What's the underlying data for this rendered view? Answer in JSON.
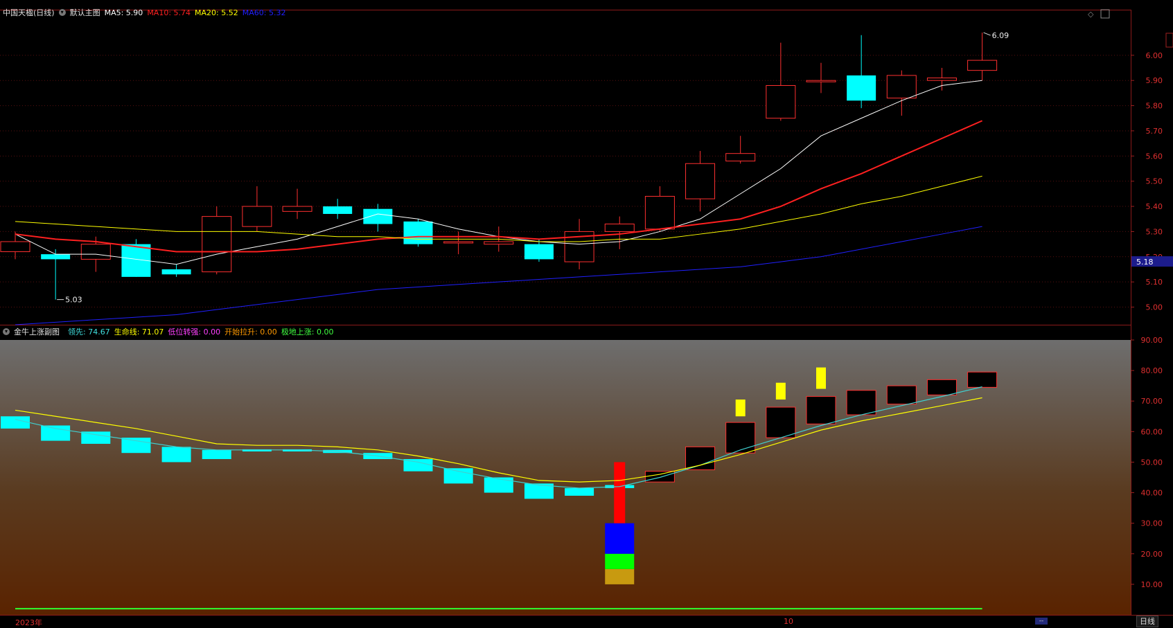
{
  "main_header": {
    "stock_name": "中国天楹(日线)",
    "indicator_name": "默认主图",
    "ma5": {
      "label": "MA5: 5.90",
      "color": "#ffffff"
    },
    "ma10": {
      "label": "MA10: 5.74",
      "color": "#ff2020"
    },
    "ma20": {
      "label": "MA20: 5.52",
      "color": "#ffff00"
    },
    "ma60": {
      "label": "MA60: 5.32",
      "color": "#2020ff"
    }
  },
  "sub_header": {
    "indicator_name": "金牛上涨副图",
    "lead": {
      "label": "领先: 74.67",
      "color": "#40e0e0"
    },
    "life": {
      "label": "生命线: 71.07",
      "color": "#ffff00"
    },
    "low_turn": {
      "label": "低位转强: 0.00",
      "color": "#ff40ff"
    },
    "start_rise": {
      "label": "开始拉升: 0.00",
      "color": "#ff9900"
    },
    "bottom_rise": {
      "label": "极地上涨: 0.00",
      "color": "#40ff40"
    }
  },
  "x_labels": {
    "year": "2023年",
    "month": "10"
  },
  "period_tab": "日线",
  "scroll_mark": "--",
  "chart_data": [
    {
      "type": "candlestick",
      "title": "中国天楹(日线)",
      "ylim": [
        4.93,
        6.17
      ],
      "yticks": [
        5.0,
        5.1,
        5.2,
        5.3,
        5.4,
        5.5,
        5.6,
        5.7,
        5.8,
        5.9,
        6.0
      ],
      "last_price_label": "5.18",
      "annotations": [
        {
          "text": "5.03",
          "index": 1
        },
        {
          "text": "6.09",
          "index": 24
        }
      ],
      "candles": [
        {
          "o": 5.22,
          "h": 5.3,
          "l": 5.19,
          "c": 5.26
        },
        {
          "o": 5.21,
          "h": 5.23,
          "l": 5.03,
          "c": 5.19
        },
        {
          "o": 5.19,
          "h": 5.28,
          "l": 5.14,
          "c": 5.25
        },
        {
          "o": 5.25,
          "h": 5.27,
          "l": 5.12,
          "c": 5.12
        },
        {
          "o": 5.15,
          "h": 5.17,
          "l": 5.12,
          "c": 5.13
        },
        {
          "o": 5.14,
          "h": 5.4,
          "l": 5.13,
          "c": 5.36
        },
        {
          "o": 5.32,
          "h": 5.48,
          "l": 5.3,
          "c": 5.4
        },
        {
          "o": 5.38,
          "h": 5.47,
          "l": 5.35,
          "c": 5.4
        },
        {
          "o": 5.4,
          "h": 5.43,
          "l": 5.35,
          "c": 5.37
        },
        {
          "o": 5.39,
          "h": 5.41,
          "l": 5.3,
          "c": 5.33
        },
        {
          "o": 5.34,
          "h": 5.35,
          "l": 5.24,
          "c": 5.25
        },
        {
          "o": 5.26,
          "h": 5.3,
          "l": 5.21,
          "c": 5.26
        },
        {
          "o": 5.25,
          "h": 5.32,
          "l": 5.22,
          "c": 5.26
        },
        {
          "o": 5.25,
          "h": 5.27,
          "l": 5.18,
          "c": 5.19
        },
        {
          "o": 5.18,
          "h": 5.35,
          "l": 5.15,
          "c": 5.3
        },
        {
          "o": 5.3,
          "h": 5.36,
          "l": 5.23,
          "c": 5.33
        },
        {
          "o": 5.31,
          "h": 5.48,
          "l": 5.3,
          "c": 5.44
        },
        {
          "o": 5.43,
          "h": 5.62,
          "l": 5.38,
          "c": 5.57
        },
        {
          "o": 5.58,
          "h": 5.68,
          "l": 5.57,
          "c": 5.61
        },
        {
          "o": 5.75,
          "h": 6.05,
          "l": 5.74,
          "c": 5.88
        },
        {
          "o": 5.9,
          "h": 5.97,
          "l": 5.85,
          "c": 5.9
        },
        {
          "o": 5.92,
          "h": 6.08,
          "l": 5.79,
          "c": 5.82
        },
        {
          "o": 5.83,
          "h": 5.94,
          "l": 5.76,
          "c": 5.92
        },
        {
          "o": 5.9,
          "h": 5.95,
          "l": 5.86,
          "c": 5.91
        },
        {
          "o": 5.94,
          "h": 6.09,
          "l": 5.9,
          "c": 5.98
        }
      ],
      "series": [
        {
          "name": "MA5",
          "color": "#ffffff",
          "width": 1,
          "values": [
            5.29,
            5.21,
            5.21,
            5.19,
            5.17,
            5.21,
            5.24,
            5.27,
            5.32,
            5.37,
            5.35,
            5.31,
            5.28,
            5.26,
            5.25,
            5.26,
            5.3,
            5.35,
            5.45,
            5.55,
            5.68,
            5.75,
            5.82,
            5.88,
            5.9
          ]
        },
        {
          "name": "MA10",
          "color": "#ff2020",
          "width": 2,
          "values": [
            5.29,
            5.27,
            5.26,
            5.24,
            5.22,
            5.22,
            5.22,
            5.23,
            5.25,
            5.27,
            5.28,
            5.28,
            5.28,
            5.27,
            5.28,
            5.29,
            5.31,
            5.33,
            5.35,
            5.4,
            5.47,
            5.53,
            5.6,
            5.67,
            5.74
          ]
        },
        {
          "name": "MA20",
          "color": "#ffff00",
          "width": 1,
          "values": [
            5.34,
            5.33,
            5.32,
            5.31,
            5.3,
            5.3,
            5.3,
            5.29,
            5.28,
            5.28,
            5.27,
            5.27,
            5.27,
            5.26,
            5.26,
            5.27,
            5.27,
            5.29,
            5.31,
            5.34,
            5.37,
            5.41,
            5.44,
            5.48,
            5.52
          ]
        },
        {
          "name": "MA60",
          "color": "#2020ff",
          "width": 1,
          "values": [
            4.93,
            4.94,
            4.95,
            4.96,
            4.97,
            4.99,
            5.01,
            5.03,
            5.05,
            5.07,
            5.08,
            5.09,
            5.1,
            5.11,
            5.12,
            5.13,
            5.14,
            5.15,
            5.16,
            5.18,
            5.2,
            5.23,
            5.26,
            5.29,
            5.32
          ]
        }
      ]
    },
    {
      "type": "bar",
      "title": "金牛上涨副图",
      "ylim": [
        0,
        90
      ],
      "yticks": [
        10,
        20,
        30,
        40,
        50,
        60,
        70,
        80,
        90
      ],
      "bars": [
        {
          "o": 61,
          "c": 65,
          "style": "cyan"
        },
        {
          "o": 57,
          "c": 62,
          "style": "cyan"
        },
        {
          "o": 56,
          "c": 60,
          "style": "cyan"
        },
        {
          "o": 53,
          "c": 58,
          "style": "cyan"
        },
        {
          "o": 50,
          "c": 55,
          "style": "cyan"
        },
        {
          "o": 51,
          "c": 54,
          "style": "cyan"
        },
        {
          "o": 53.5,
          "c": 54.2,
          "style": "cyan"
        },
        {
          "o": 53.5,
          "c": 54.2,
          "style": "cyan"
        },
        {
          "o": 53,
          "c": 54,
          "style": "cyan"
        },
        {
          "o": 51,
          "c": 53,
          "style": "cyan"
        },
        {
          "o": 47,
          "c": 51,
          "style": "cyan"
        },
        {
          "o": 43,
          "c": 48,
          "style": "cyan"
        },
        {
          "o": 40,
          "c": 45,
          "style": "cyan"
        },
        {
          "o": 38,
          "c": 43,
          "style": "cyan"
        },
        {
          "o": 39,
          "c": 41.5,
          "style": "cyan"
        },
        {
          "o": 41.5,
          "c": 42.5,
          "style": "cyan"
        },
        {
          "o": 43.5,
          "c": 47,
          "style": "hollow"
        },
        {
          "o": 47.5,
          "c": 55,
          "style": "hollow"
        },
        {
          "o": 53,
          "c": 63,
          "style": "hollow"
        },
        {
          "o": 58,
          "c": 68,
          "style": "hollow"
        },
        {
          "o": 62.5,
          "c": 71.5,
          "style": "hollow"
        },
        {
          "o": 65.5,
          "c": 73.5,
          "style": "hollow"
        },
        {
          "o": 69,
          "c": 75,
          "style": "hollow"
        },
        {
          "o": 72,
          "c": 77,
          "style": "hollow"
        },
        {
          "o": 74.5,
          "c": 79.5,
          "style": "hollow"
        }
      ],
      "signal_stack": {
        "index": 15,
        "segments": [
          {
            "from": 10,
            "to": 15,
            "color": "#c89a10"
          },
          {
            "from": 15,
            "to": 20,
            "color": "#00ff00"
          },
          {
            "from": 20,
            "to": 30,
            "color": "#0000ff"
          },
          {
            "from": 30,
            "to": 50,
            "color": "#ff0000"
          }
        ]
      },
      "markers": [
        {
          "index": 18,
          "from": 65,
          "to": 70.5,
          "color": "#ffff00"
        },
        {
          "index": 19,
          "from": 70.5,
          "to": 76,
          "color": "#ffff00"
        },
        {
          "index": 20,
          "from": 74,
          "to": 81,
          "color": "#ffff00"
        }
      ],
      "series": [
        {
          "name": "领先",
          "color": "#40d0d0",
          "values": [
            64,
            61,
            59,
            57,
            55,
            54,
            54,
            54,
            53.5,
            52,
            50,
            47,
            44.5,
            42.5,
            41.5,
            42,
            45,
            49,
            54,
            58,
            62,
            65.5,
            68.5,
            71.5,
            74.67
          ]
        },
        {
          "name": "生命线",
          "color": "#ffff00",
          "values": [
            67,
            65,
            63,
            61,
            58.5,
            56,
            55.5,
            55.5,
            55,
            54,
            52,
            49.5,
            46.5,
            44,
            43.5,
            44,
            46,
            49,
            52.5,
            56.5,
            60.5,
            63.5,
            66,
            68.5,
            71.07
          ]
        },
        {
          "name": "极地上涨",
          "color": "#30ff30",
          "values": [
            2,
            2,
            2,
            2,
            2,
            2,
            2,
            2,
            2,
            2,
            2,
            2,
            2,
            2,
            2,
            2,
            2,
            2,
            2,
            2,
            2,
            2,
            2,
            2,
            2
          ]
        }
      ]
    }
  ]
}
